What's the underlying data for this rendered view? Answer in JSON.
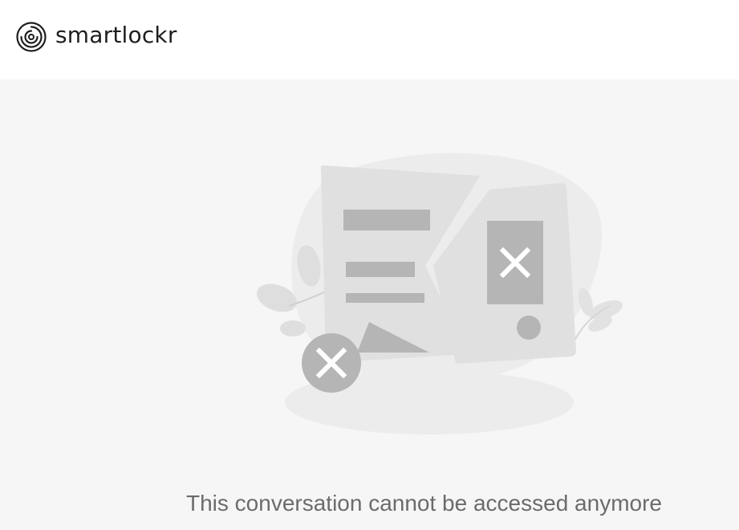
{
  "header": {
    "brand_name": "smartlockr",
    "logo_icon": "concentric-circles-logo-icon"
  },
  "main": {
    "illustration_icon": "broken-document-error-illustration",
    "message": "This conversation cannot be accessed anymore"
  },
  "colors": {
    "header_bg": "#ffffff",
    "page_bg": "#f6f6f6",
    "brand_text": "#1e1e1e",
    "message_text": "#6b6b6b",
    "illustration_light": "#e0e0e0",
    "illustration_mid": "#b5b5b5",
    "illustration_bg": "#ececec"
  }
}
